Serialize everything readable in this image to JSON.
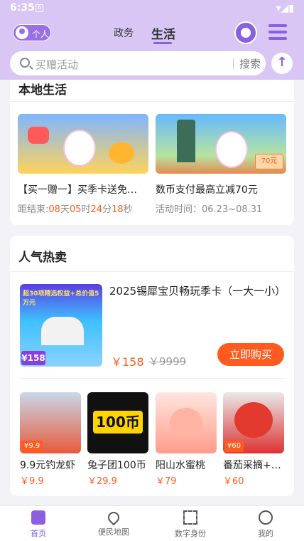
{
  "status_bar": {
    "time": "6:35",
    "notif_glyph": "A"
  },
  "header": {
    "personal_label": "个人",
    "tabs": [
      {
        "label": "政务",
        "active": false
      },
      {
        "label": "生活",
        "active": true
      }
    ],
    "accent_color": "#8a5fe0"
  },
  "search": {
    "placeholder": "买赠活动",
    "button": "搜索"
  },
  "local_life": {
    "title": "本地生活",
    "activities": [
      {
        "title": "【买一赠一】买季卡送免…",
        "meta_prefix": "距结束:",
        "countdown": [
          {
            "v": "08",
            "u": "天"
          },
          {
            "v": "05",
            "u": "时"
          },
          {
            "v": "24",
            "u": "分"
          },
          {
            "v": "18",
            "u": "秒"
          }
        ]
      },
      {
        "title": "数币支付最高立减70元",
        "meta": "活动时间：06.23~08.31",
        "banner_tag": "70元"
      }
    ]
  },
  "hot_sale": {
    "title": "人气热卖",
    "featured": {
      "name": "2025锡犀宝贝畅玩季卡（一大一小）",
      "price": "￥158",
      "original_price": "￥9999",
      "buy_label": "立即购买",
      "image_header": "超30项精选权益+总价值5万元",
      "image_price": "¥158"
    },
    "products": [
      {
        "name": "9.9元钓龙虾",
        "price": "￥9.9",
        "badge": "¥9.9"
      },
      {
        "name": "兔子团100币",
        "price": "￥29.9",
        "image_text": "100币"
      },
      {
        "name": "阳山水蜜桃",
        "price": "￥79"
      },
      {
        "name": "番茄采摘+…",
        "price": "￥60",
        "badge": "¥60"
      }
    ]
  },
  "bottom_nav": [
    {
      "label": "首页",
      "icon": "home-icon",
      "active": true
    },
    {
      "label": "便民地图",
      "icon": "map-pin-icon",
      "active": false
    },
    {
      "label": "数字身份",
      "icon": "qr-scan-icon",
      "active": false
    },
    {
      "label": "我的",
      "icon": "smile-icon",
      "active": false
    }
  ],
  "colors": {
    "accent": "#8a5fe0",
    "price": "#ff5a1f",
    "header_bg": "#d9c6f5"
  }
}
